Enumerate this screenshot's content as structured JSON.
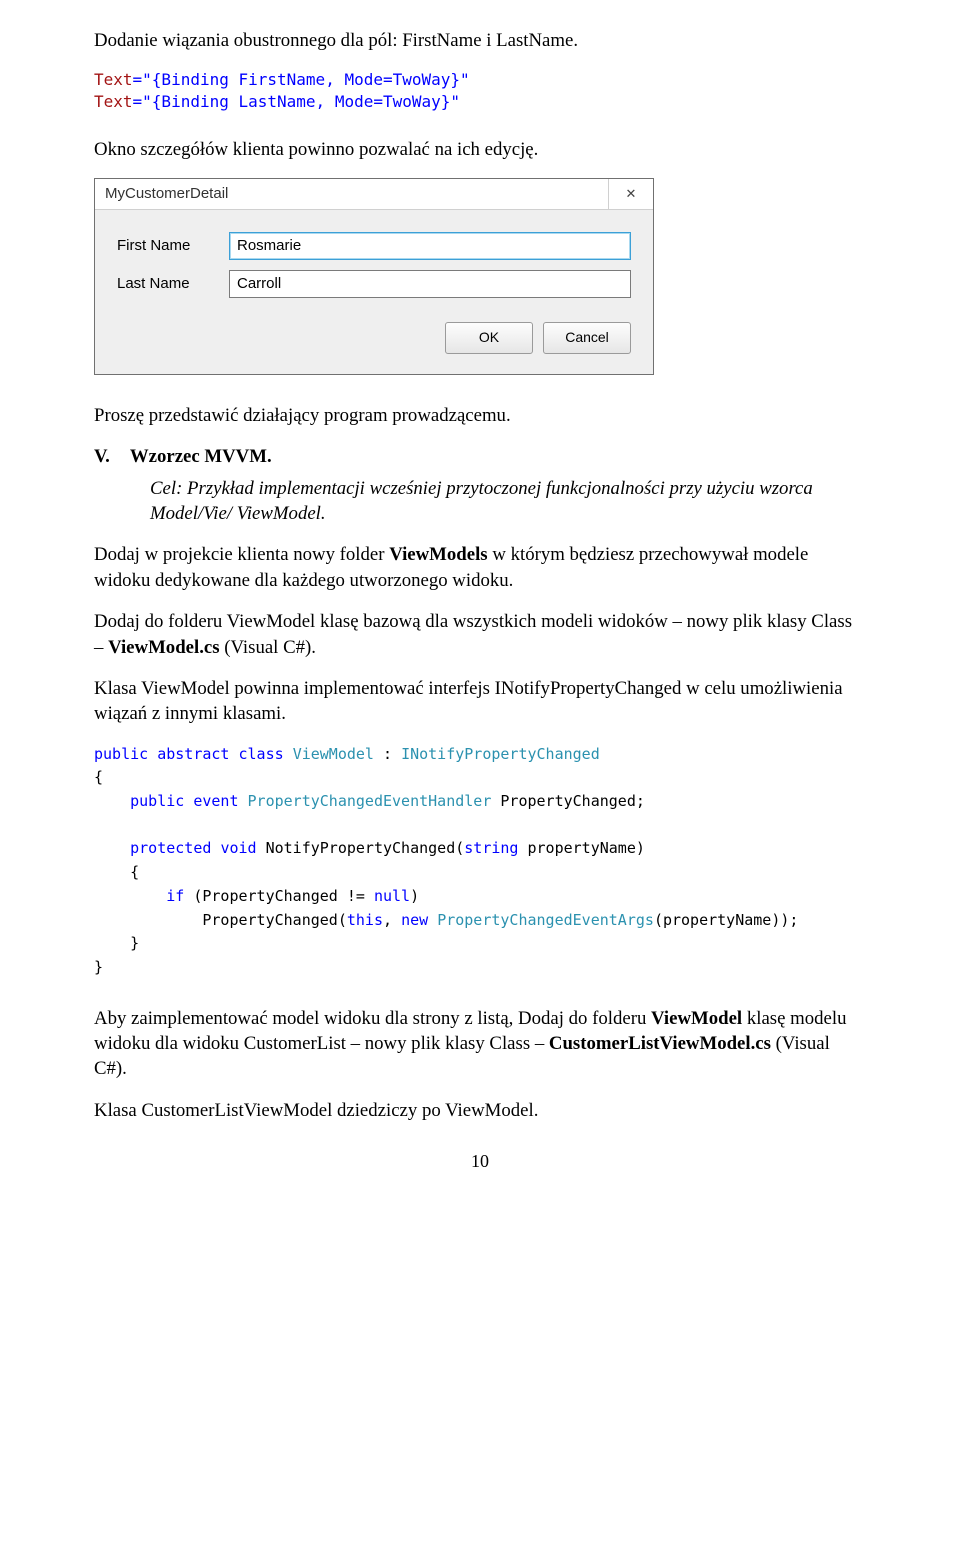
{
  "heading1": "Dodanie wiązania obustronnego dla pól: FirstName i LastName.",
  "codeSnippet1": {
    "l1a": "Text",
    "l1b": "=\"{Binding FirstName, Mode=TwoWay}\"",
    "l2a": "Text",
    "l2b": "=\"{Binding LastName, Mode=TwoWay}\""
  },
  "para2": "Okno szczegółów klienta powinno pozwalać na ich edycję.",
  "dialog": {
    "title": "MyCustomerDetail",
    "close": "✕",
    "firstLabel": "First Name",
    "firstValue": "Rosmarie",
    "lastLabel": "Last Name",
    "lastValue": "Carroll",
    "ok": "OK",
    "cancel": "Cancel"
  },
  "para3": "Proszę przedstawić działający program prowadzącemu.",
  "section": {
    "num": "V.",
    "title": "Wzorzec MVVM."
  },
  "purpose": "Cel: Przykład implementacji wcześniej przytoczonej funkcjonalności przy użyciu wzorca Model/Vie/ ViewModel.",
  "para5a": "Dodaj w projekcie klienta nowy folder ",
  "para5b": "ViewModels",
  "para5c": " w którym będziesz przechowywał modele widoku dedykowane dla każdego utworzonego widoku.",
  "para6a": "Dodaj do folderu ViewModel klasę bazową dla wszystkich modeli widoków – nowy plik klasy Class – ",
  "para6b": "ViewModel.cs",
  "para6c": " (Visual C#).",
  "para7": "Klasa ViewModel powinna implementować interfejs INotifyPropertyChanged w celu umożliwienia wiązań z innymi klasami.",
  "code2": {
    "kw_public": "public",
    "kw_abstract": "abstract",
    "kw_class": "class",
    "cls_ViewModel": "ViewModel",
    "cls_INotify": "INotifyPropertyChanged",
    "kw_event": "event",
    "cls_Handler": "PropertyChangedEventHandler",
    "ev_name": "PropertyChanged;",
    "kw_protected": "protected",
    "kw_void": "void",
    "m_notify": "NotifyPropertyChanged(",
    "kw_string": "string",
    "p_name": " propertyName)",
    "kw_if": "if",
    "cond": " (PropertyChanged != ",
    "kw_null": "null",
    "cond2": ")",
    "call1": "PropertyChanged(",
    "kw_this": "this",
    "call2": ", ",
    "kw_new": "new",
    "cls_Args": "PropertyChangedEventArgs",
    "call3": "(propertyName));"
  },
  "para8a": "Aby zaimplementować model widoku dla strony z listą, Dodaj do folderu ",
  "para8b": "ViewModel",
  "para8c": " klasę modelu widoku dla widoku CustomerList – nowy plik klasy Class – ",
  "para8d": "CustomerListViewModel.cs",
  "para8e": " (Visual C#).",
  "para9": "Klasa CustomerListViewModel dziedziczy po ViewModel.",
  "pageNum": "10"
}
